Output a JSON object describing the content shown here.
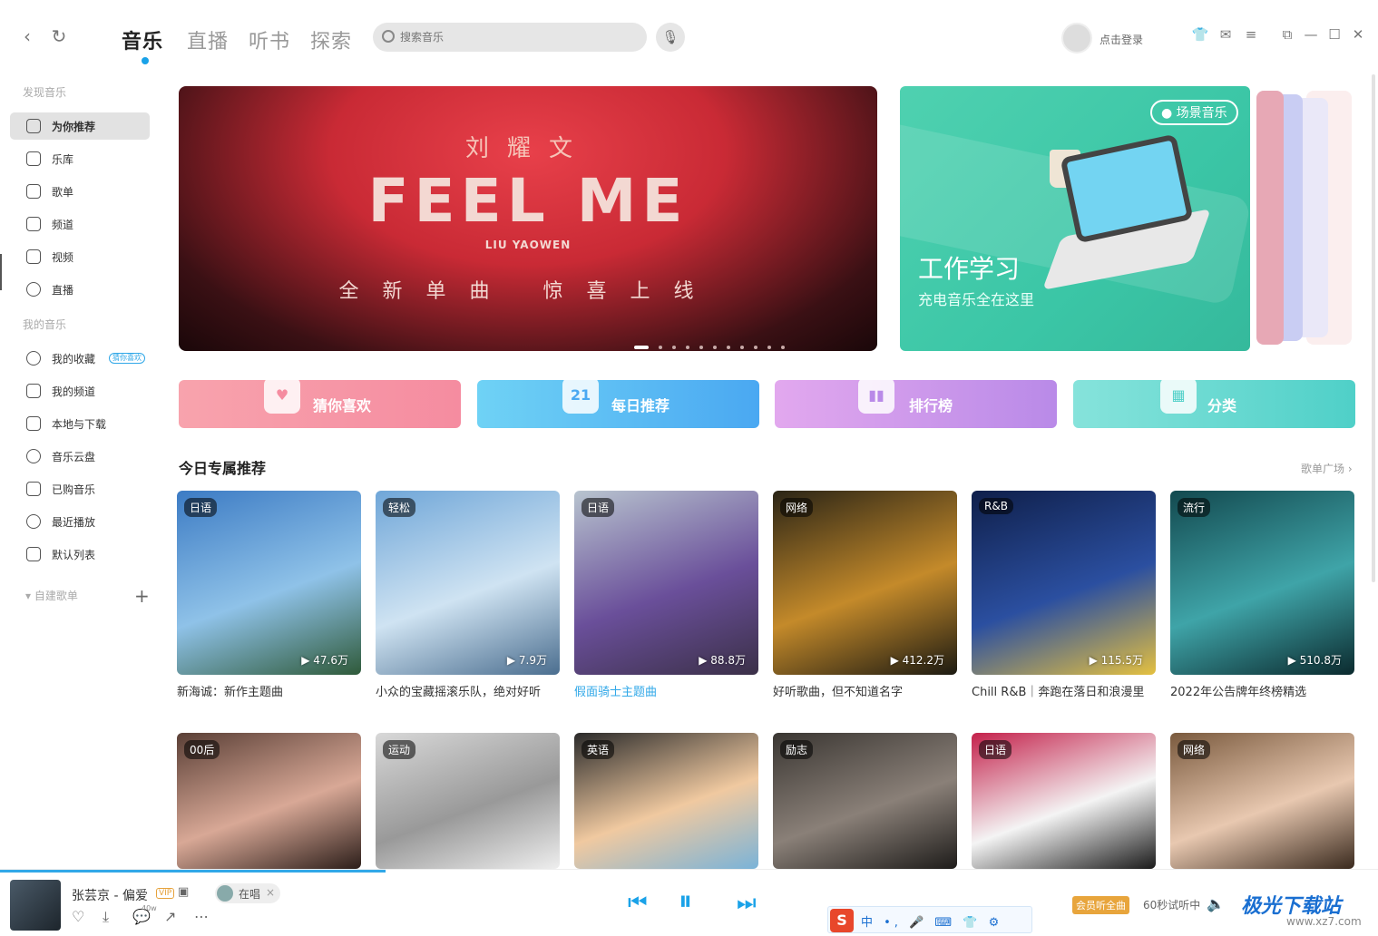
{
  "topbar": {
    "tabs": [
      {
        "label": "音乐",
        "active": true
      },
      {
        "label": "直播",
        "active": false
      },
      {
        "label": "听书",
        "active": false
      },
      {
        "label": "探索",
        "active": false
      }
    ],
    "search_placeholder": "搜索音乐",
    "login_label": "点击登录",
    "accent_color": "#1aa2e8"
  },
  "sidebar": {
    "discover_title": "发现音乐",
    "discover_items": [
      {
        "label": "为你推荐",
        "icon": "star-icon",
        "active": true
      },
      {
        "label": "乐库",
        "icon": "music-note-icon"
      },
      {
        "label": "歌单",
        "icon": "playlist-icon"
      },
      {
        "label": "频道",
        "icon": "radio-icon"
      },
      {
        "label": "视频",
        "icon": "video-icon"
      },
      {
        "label": "直播",
        "icon": "live-icon"
      }
    ],
    "mine_title": "我的音乐",
    "mine_items": [
      {
        "label": "我的收藏",
        "icon": "heart-icon",
        "badge": "猜你喜欢"
      },
      {
        "label": "我的频道",
        "icon": "radio-icon"
      },
      {
        "label": "本地与下载",
        "icon": "download-icon"
      },
      {
        "label": "音乐云盘",
        "icon": "cloud-icon"
      },
      {
        "label": "已购音乐",
        "icon": "bag-icon"
      },
      {
        "label": "最近播放",
        "icon": "clock-icon"
      },
      {
        "label": "默认列表",
        "icon": "list-icon"
      }
    ],
    "created_title": "自建歌单"
  },
  "banner": {
    "artist": "刘耀文",
    "title": "FEEL ME",
    "artist_en": "LIU YAOWEN",
    "subtitle": "全新单曲 惊喜上线",
    "dots_total": 11,
    "dot_active": 0
  },
  "scene_card": {
    "tag": "场景音乐",
    "title": "工作学习",
    "subtitle": "充电音乐全在这里"
  },
  "categories": [
    {
      "label": "猜你喜欢",
      "icon": "heart-icon",
      "color_from": "#f8a3ad",
      "color_to": "#f58ca0"
    },
    {
      "label": "每日推荐",
      "icon": "calendar-icon",
      "icon_text": "21",
      "color_from": "#6fd2f5",
      "color_to": "#4aa8f2"
    },
    {
      "label": "排行榜",
      "icon": "bar-chart-icon",
      "color_from": "#e2a8ee",
      "color_to": "#b98ae8"
    },
    {
      "label": "分类",
      "icon": "grid-icon",
      "color_from": "#86e3db",
      "color_to": "#4fd0c8"
    }
  ],
  "section": {
    "title": "今日专属推荐",
    "more": "歌单广场 ›"
  },
  "cards_row1": [
    {
      "tag": "日语",
      "plays": "▶ 47.6万",
      "title": "新海诚：新作主题曲",
      "c1": "#3c7bc4",
      "c2": "#8fc2e8",
      "c3": "#2f5a3a"
    },
    {
      "tag": "轻松",
      "plays": "▶ 7.9万",
      "title": "小众的宝藏摇滚乐队，绝对好听",
      "c1": "#6fa6d8",
      "c2": "#cfe3f2",
      "c3": "#4b6e8f"
    },
    {
      "tag": "日语",
      "plays": "▶ 88.8万",
      "title": "假面骑士主题曲",
      "c1": "#b8c4cf",
      "c2": "#6a4f9a",
      "c3": "#3b3048",
      "highlight": true
    },
    {
      "tag": "网络",
      "plays": "▶ 412.2万",
      "title": "好听歌曲，但不知道名字",
      "c1": "#2a2416",
      "c2": "#c48a2a",
      "c3": "#1c1a12"
    },
    {
      "tag": "R&B",
      "plays": "▶ 115.5万",
      "title": "Chill R&B｜奔跑在落日和浪漫里",
      "c1": "#0f1f4a",
      "c2": "#2b4fa0",
      "c3": "#e4c040"
    },
    {
      "tag": "流行",
      "plays": "▶ 510.8万",
      "title": "2022年公告牌年终榜精选",
      "c1": "#13494f",
      "c2": "#3fa4a8",
      "c3": "#0b2a2e"
    }
  ],
  "cards_row2": [
    {
      "tag": "00后",
      "c1": "#5a3f36",
      "c2": "#d8a896",
      "c3": "#2c1e1a"
    },
    {
      "tag": "运动",
      "c1": "#d8d8d8",
      "c2": "#999999",
      "c3": "#eeeeee"
    },
    {
      "tag": "英语",
      "c1": "#2a2a2a",
      "c2": "#f0c9a0",
      "c3": "#7ab3d8"
    },
    {
      "tag": "励志",
      "c1": "#3a3632",
      "c2": "#8a8078",
      "c3": "#1e1c1a"
    },
    {
      "tag": "日语",
      "c1": "#c4214b",
      "c2": "#f4f4f4",
      "c3": "#1a1a1a"
    },
    {
      "tag": "网络",
      "c1": "#7a5a3e",
      "c2": "#e8c8b0",
      "c3": "#3a2a1e"
    }
  ],
  "player": {
    "song": "张芸京 - 偏爱",
    "vip_badge": "VIP",
    "singing_label": "在唱",
    "close_label": "×",
    "comment_count": "40w",
    "vip_listen": "会员听全曲",
    "trial": "60秒试听中",
    "progress": 0.28
  },
  "ime": {
    "logo": "S",
    "text": "中 •, 🎤 ⌨ 👕 ⚙"
  },
  "watermark": {
    "text": "极光下载站",
    "url": "www.xz7.com"
  }
}
